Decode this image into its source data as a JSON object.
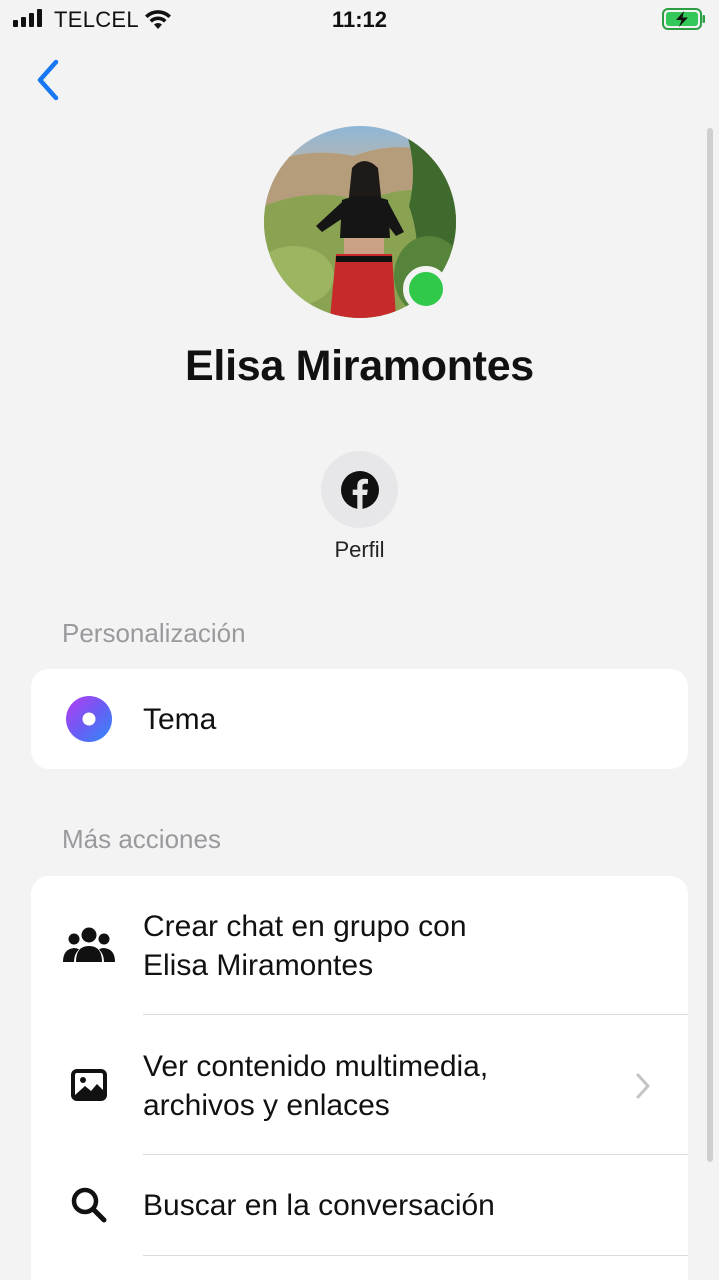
{
  "status_bar": {
    "carrier": "TELCEL",
    "time": "11:12"
  },
  "contact": {
    "name": "Elisa Miramontes",
    "online": true
  },
  "actions": {
    "profile_label": "Perfil"
  },
  "sections": {
    "personalization_title": "Personalización",
    "theme_label": "Tema",
    "more_actions_title": "Más acciones",
    "more_actions": [
      {
        "line1": "Crear chat en grupo con",
        "line2": "Elisa Miramontes",
        "icon": "group-icon"
      },
      {
        "line1": "Ver contenido multimedia,",
        "line2": "archivos y enlaces",
        "icon": "image-icon"
      },
      {
        "line1": "Buscar en la conversación",
        "line2": "",
        "icon": "search-icon"
      }
    ]
  },
  "colors": {
    "accent_blue": "#1877f2",
    "online_green": "#31c94a",
    "background": "#f3f3f4",
    "battery_green": "#34c759"
  }
}
